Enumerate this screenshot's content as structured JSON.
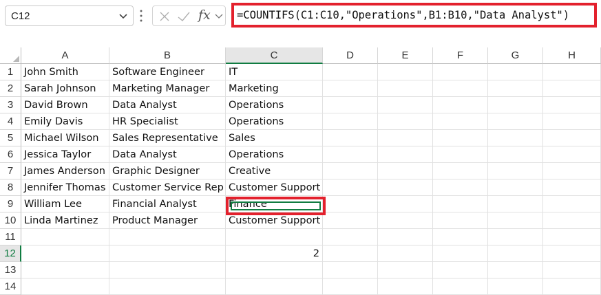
{
  "name_box": {
    "value": "C12"
  },
  "formula_bar": {
    "fx_label": "fx",
    "formula": "=COUNTIFS(C1:C10,\"Operations\",B1:B10,\"Data Analyst\")"
  },
  "columns": [
    "A",
    "B",
    "C",
    "D",
    "E",
    "F",
    "G",
    "H"
  ],
  "rows": [
    "1",
    "2",
    "3",
    "4",
    "5",
    "6",
    "7",
    "8",
    "9",
    "10",
    "11",
    "12",
    "13",
    "14"
  ],
  "selected": {
    "column": "C",
    "row": "12"
  },
  "data": [
    [
      "John Smith",
      "Software Engineer",
      "IT"
    ],
    [
      "Sarah Johnson",
      "Marketing Manager",
      "Marketing"
    ],
    [
      "David Brown",
      "Data Analyst",
      "Operations"
    ],
    [
      "Emily Davis",
      "HR Specialist",
      "Operations"
    ],
    [
      "Michael Wilson",
      "Sales Representative",
      "Sales"
    ],
    [
      "Jessica Taylor",
      "Data Analyst",
      "Operations"
    ],
    [
      "James Anderson",
      "Graphic Designer",
      "Creative"
    ],
    [
      "Jennifer Thomas",
      "Customer Service Rep",
      "Customer Support"
    ],
    [
      "William Lee",
      "Financial Analyst",
      "Finance"
    ],
    [
      "Linda Martinez",
      "Product Manager",
      "Customer Support"
    ]
  ],
  "result_cell": {
    "ref": "C12",
    "value": "2"
  },
  "colors": {
    "highlight": "#e3212d",
    "excel_green": "#107c41",
    "header_sel_bg": "#e6e6e6"
  }
}
